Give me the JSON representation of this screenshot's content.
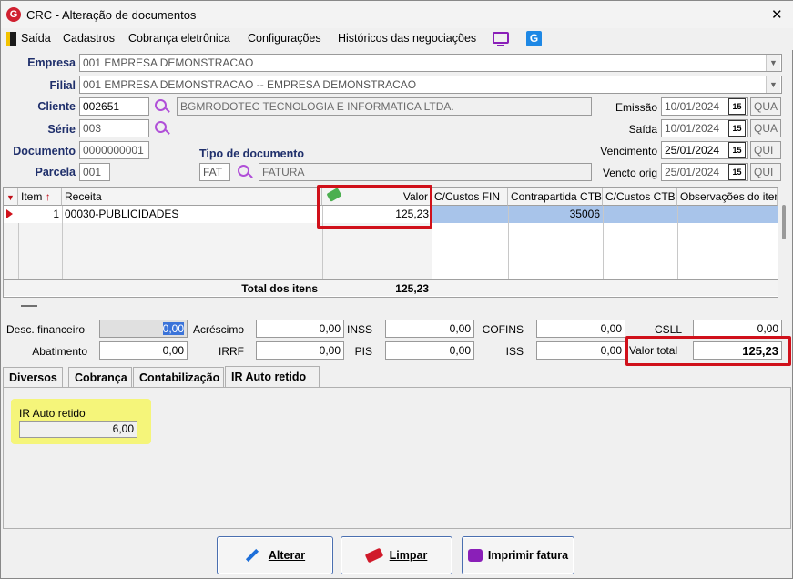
{
  "window": {
    "title": "CRC - Alteração de documentos",
    "close_glyph": "✕"
  },
  "menu": [
    "Saída",
    "Cadastros",
    "Cobrança eletrônica",
    "Configurações",
    "Históricos das negociações"
  ],
  "form": {
    "empresa_label": "Empresa",
    "empresa_value": "001 EMPRESA DEMONSTRACAO",
    "filial_label": "Filial",
    "filial_value": "001 EMPRESA DEMONSTRACAO -- EMPRESA DEMONSTRACAO",
    "cliente_label": "Cliente",
    "cliente_code": "002651",
    "cliente_name": "BGMRODOTEC TECNOLOGIA E INFORMATICA LTDA.",
    "serie_label": "Série",
    "serie_value": "003",
    "documento_label": "Documento",
    "documento_value": "0000000001",
    "parcela_label": "Parcela",
    "parcela_value": "001",
    "tipo_label": "Tipo de documento",
    "tipo_code": "FAT",
    "tipo_name": "FATURA",
    "emissao_label": "Emissão",
    "emissao_date": "10/01/2024",
    "emissao_day": "QUA",
    "saida_label": "Saída",
    "saida_date": "10/01/2024",
    "saida_day": "QUA",
    "vencimento_label": "Vencimento",
    "vencimento_date": "25/01/2024",
    "vencimento_day": "QUI",
    "vencto_orig_label": "Vencto orig",
    "vencto_orig_date": "25/01/2024",
    "vencto_orig_day": "QUI",
    "cal_glyph": "15"
  },
  "grid": {
    "columns": [
      "Item",
      "Receita",
      "Valor",
      "C/Custos FIN",
      "Contrapartida CTB",
      "C/Custos CTB",
      "Observações do item"
    ],
    "rows": [
      {
        "item": "1",
        "receita": "00030-PUBLICIDADES",
        "valor": "125,23",
        "ccustos_fin": "",
        "contrapartida": "35006",
        "ccustos_ctb": "",
        "obs": ""
      }
    ],
    "total_label": "Total dos itens",
    "total_value": "125,23"
  },
  "totals": {
    "desc_fin_label": "Desc. financeiro",
    "desc_fin": "0,00",
    "acrescimo_label": "Acréscimo",
    "acrescimo": "0,00",
    "inss_label": "INSS",
    "inss": "0,00",
    "cofins_label": "COFINS",
    "cofins": "0,00",
    "csll_label": "CSLL",
    "csll": "0,00",
    "abatimento_label": "Abatimento",
    "abatimento": "0,00",
    "irrf_label": "IRRF",
    "irrf": "0,00",
    "pis_label": "PIS",
    "pis": "0,00",
    "iss_label": "ISS",
    "iss": "0,00",
    "valor_total_label": "Valor total",
    "valor_total": "125,23"
  },
  "tabs": [
    "Diversos",
    "Cobrança",
    "Contabilização",
    "IR Auto retido"
  ],
  "ir_panel": {
    "label": "IR Auto retido",
    "value": "6,00"
  },
  "buttons": {
    "alterar": "Alterar",
    "limpar": "Limpar",
    "imprimir": "Imprimir fatura"
  },
  "colors": {
    "label_blue": "#1f2f6b",
    "highlight_red": "#d0101a",
    "yellow_box": "#f5f57a",
    "row_selected": "#a8c4ea"
  }
}
